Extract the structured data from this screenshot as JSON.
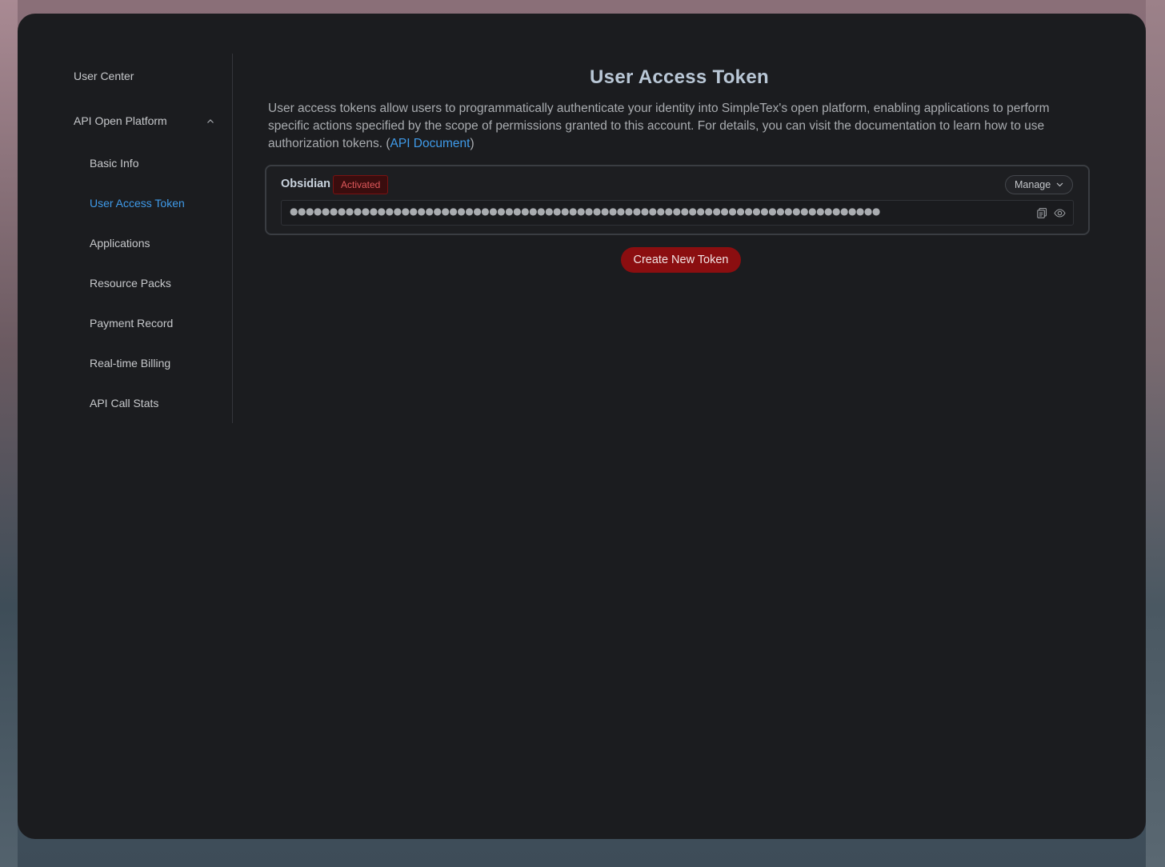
{
  "sidebar": {
    "items": [
      {
        "label": "User Center"
      },
      {
        "label": "API Open Platform"
      },
      {
        "label": "Basic Info"
      },
      {
        "label": "User Access Token"
      },
      {
        "label": "Applications"
      },
      {
        "label": "Resource Packs"
      },
      {
        "label": "Payment Record"
      },
      {
        "label": "Real-time Billing"
      },
      {
        "label": "API Call Stats"
      }
    ],
    "active_item": "User Access Token"
  },
  "main": {
    "title": "User Access Token",
    "description": "User access tokens allow users to programmatically authenticate your identity into SimpleTex's open platform, enabling applications to perform specific actions specified by the scope of permissions granted to this account. For details, you can visit the documentation to learn how to use authorization tokens. (",
    "doc_link": "API Document",
    "description_end": ")",
    "token": {
      "name": "Obsidian",
      "status": "Activated",
      "manage_label": "Manage",
      "masked_value": "●●●●●●●●●●●●●●●●●●●●●●●●●●●●●●●●●●●●●●●●●●●●●●●●●●●●●●●●●●●●●●●●●●●●●●●●●●"
    },
    "create_button": "Create New Token"
  },
  "colors": {
    "accent": "#3f9bea",
    "danger": "#8b0e10",
    "badge_text": "#e0595b"
  }
}
